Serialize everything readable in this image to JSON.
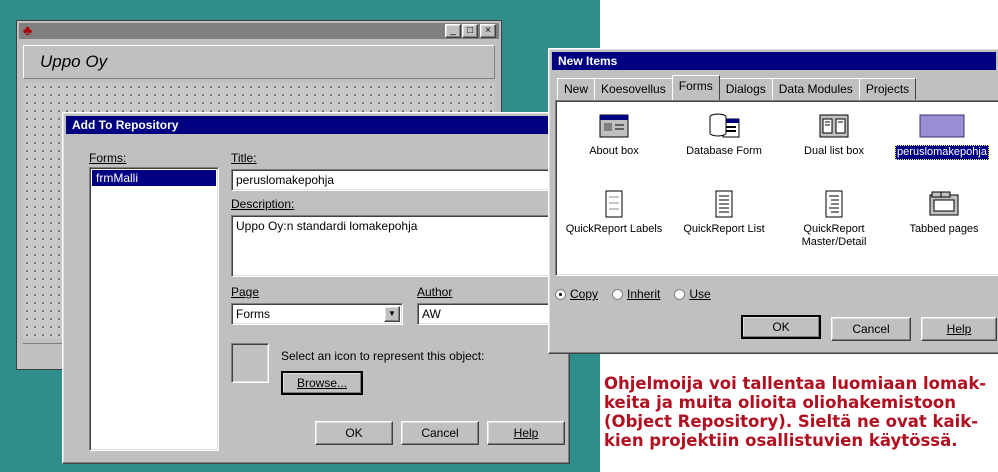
{
  "form_window": {
    "caption": "Uppo Oy",
    "min": "_",
    "max": "□",
    "close": "×"
  },
  "add_dialog": {
    "title": "Add To Repository",
    "forms_label": "Forms:",
    "forms_items": [
      "frmMalli"
    ],
    "title_label": "Title:",
    "title_value": "peruslomakepohja",
    "description_label": "Description:",
    "description_value": "Uppo Oy:n standardi lomakepohja",
    "page_label": "Page",
    "page_value": "Forms",
    "author_label": "Author",
    "author_value": "AW",
    "icon_prompt": "Select an icon to represent this object:",
    "browse_label": "Browse...",
    "ok_label": "OK",
    "cancel_label": "Cancel",
    "help_label": "Help"
  },
  "new_items": {
    "title": "New Items",
    "tabs": [
      "New",
      "Koesovellus",
      "Forms",
      "Dialogs",
      "Data Modules",
      "Projects"
    ],
    "active_tab": "Forms",
    "items": [
      {
        "label": "About box",
        "icon": "about-box-icon"
      },
      {
        "label": "Database Form",
        "icon": "database-form-icon"
      },
      {
        "label": "Dual list box",
        "icon": "dual-list-box-icon"
      },
      {
        "label": "peruslomakepohja",
        "icon": "form-template-icon",
        "selected": true
      },
      {
        "label": "QuickReport Labels",
        "icon": "report-labels-icon"
      },
      {
        "label": "QuickReport List",
        "icon": "report-list-icon"
      },
      {
        "label": "QuickReport Master/Detail",
        "icon": "report-master-detail-icon"
      },
      {
        "label": "Tabbed pages",
        "icon": "tabbed-pages-icon"
      }
    ],
    "radio_copy": "Copy",
    "radio_inherit": "Inherit",
    "radio_use": "Use",
    "ok_label": "OK",
    "cancel_label": "Cancel",
    "help_label": "Help"
  },
  "caption": {
    "lines": [
      "Ohjelmoija voi tallentaa luomiaan lomak-",
      "keita ja muita olioita oliohakemistoon",
      "(Object Repository). Sieltä ne ovat kaik-",
      "kien projektiin osallistuvien käytössä."
    ]
  },
  "colors": {
    "desktop": "#2f8e8a",
    "title_active": "#000080",
    "caption_text": "#b01020"
  }
}
